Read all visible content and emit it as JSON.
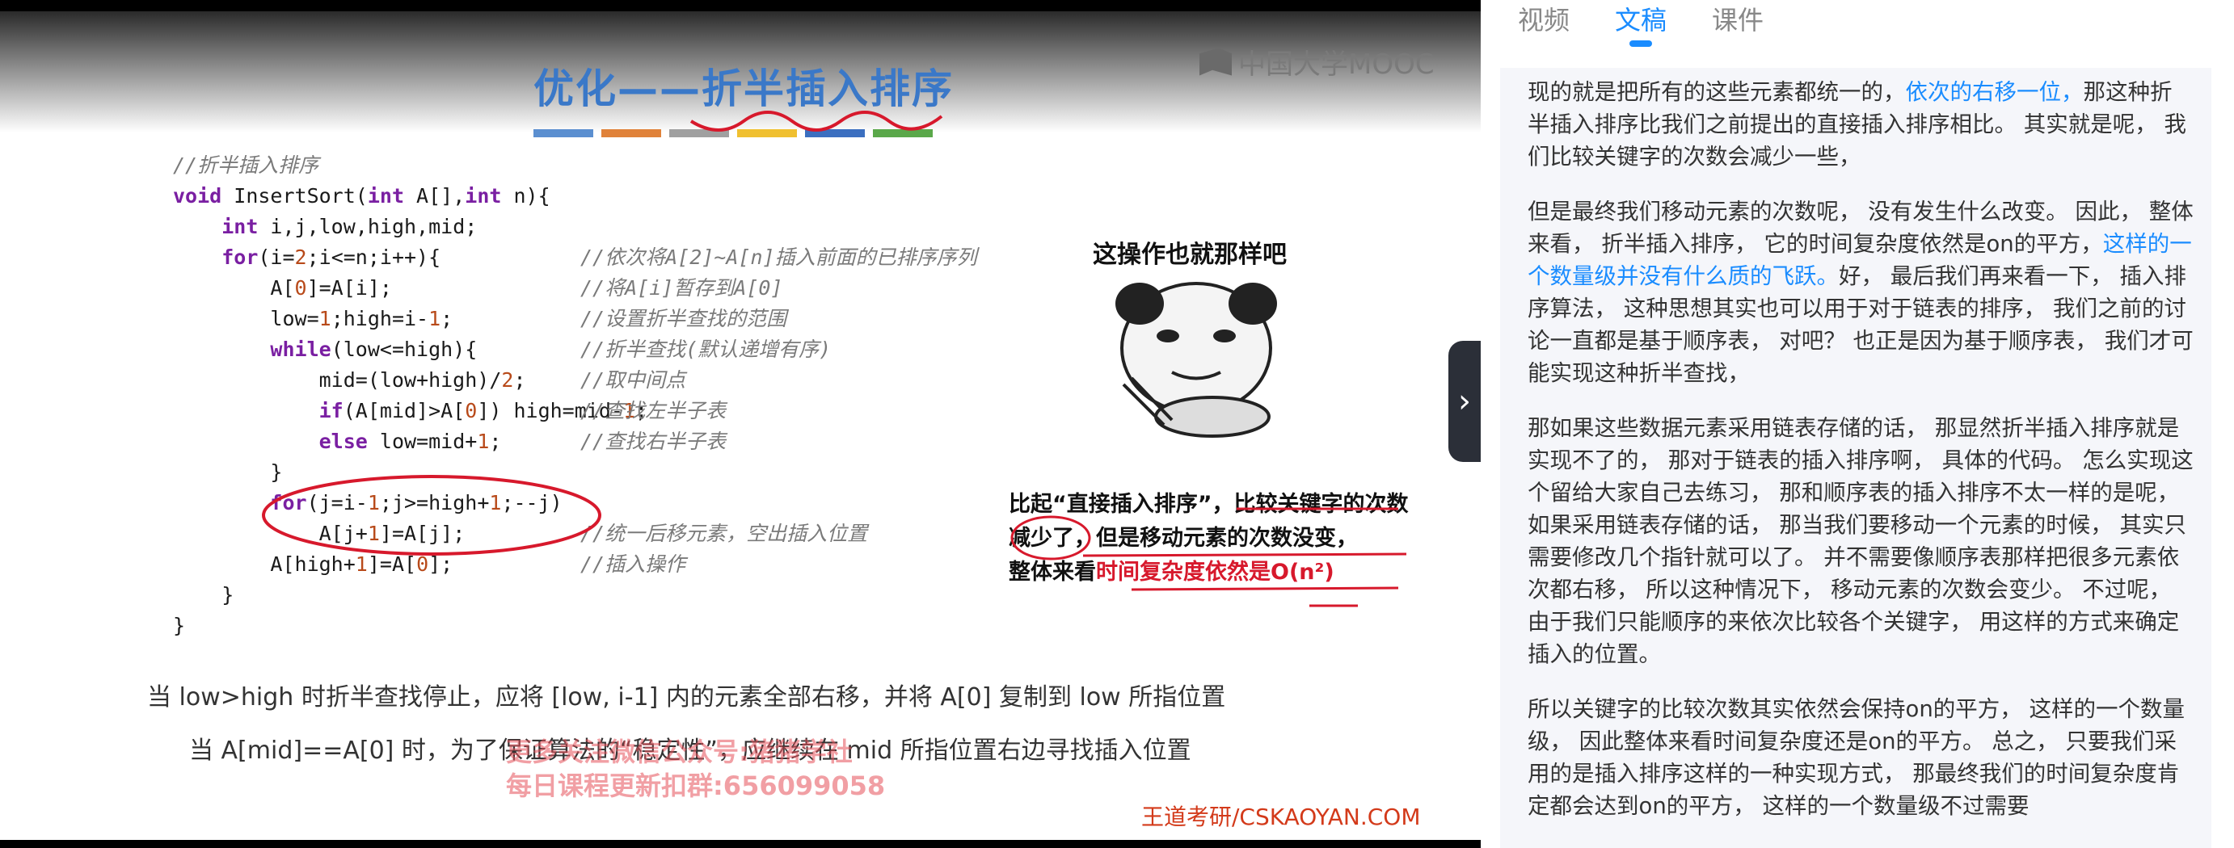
{
  "slide": {
    "title": "优化——折半插入排序",
    "logo": "中国大学MOOC",
    "code_lines": [
      {
        "code": "//折半插入排序",
        "comment": ""
      },
      {
        "code": "void InsertSort(int A[],int n){",
        "comment": ""
      },
      {
        "code": "    int i,j,low,high,mid;",
        "comment": ""
      },
      {
        "code": "    for(i=2;i<=n;i++){",
        "comment": "//依次将A[2]~A[n]插入前面的已排序序列"
      },
      {
        "code": "        A[0]=A[i];",
        "comment": "//将A[i]暂存到A[0]"
      },
      {
        "code": "        low=1;high=i-1;",
        "comment": "//设置折半查找的范围"
      },
      {
        "code": "        while(low<=high){",
        "comment": "//折半查找(默认递增有序)"
      },
      {
        "code": "            mid=(low+high)/2;",
        "comment": "//取中间点"
      },
      {
        "code": "            if(A[mid]>A[0]) high=mid-1;",
        "comment": "//查找左半子表"
      },
      {
        "code": "            else low=mid+1;",
        "comment": "//查找右半子表"
      },
      {
        "code": "        }",
        "comment": ""
      },
      {
        "code": "        for(j=i-1;j>=high+1;--j)",
        "comment": ""
      },
      {
        "code": "            A[j+1]=A[j];",
        "comment": "//统一后移元素，空出插入位置"
      },
      {
        "code": "        A[high+1]=A[0];",
        "comment": "//插入操作"
      },
      {
        "code": "    }",
        "comment": ""
      },
      {
        "code": "}",
        "comment": ""
      }
    ],
    "meme_caption": "这操作也就那样吧",
    "compare_note": {
      "line1": "比起“直接插入排序”，比较关键字的次数减少了，但是移动元素的次数没变，",
      "line2_prefix": "整体来看",
      "line2_red": "时间复杂度依然是O(n²)"
    },
    "footnote1": "当 low>high 时折半查找停止，应将 [low, i-1] 内的元素全部右移，并将 A[0] 复制到 low 所指位置",
    "footnote2": "当 A[mid]==A[0] 时，为了保证算法的“稳定性”，应继续在 mid 所指位置右边寻找插入位置",
    "watermark1": "更多关注微信公众号:猪猪学社",
    "watermark2": "每日课程更新扣群:656099058",
    "site": "王道考研/CSKAOYAN.COM"
  },
  "tabs": [
    "视频",
    "文稿",
    "课件"
  ],
  "active_tab": "文稿",
  "transcript": {
    "p1": {
      "a": "现的就是把所有的这些元素都统一的，",
      "hl": "依次的右移一位，",
      "b": "那这种折半插入排序比我们之前提出的直接插入排序相比。 其实就是呢， 我们比较关键字的次数会减少一些，"
    },
    "p2": {
      "a": "但是最终我们移动元素的次数呢， 没有发生什么改变。 因此， 整体来看， 折半插入排序， 它的时间复杂度依然是on的平方，",
      "hl": "这样的一个数量级并没有什么质的飞跃。",
      "b": "好， 最后我们再来看一下， 插入排序算法， 这种思想其实也可以用于对于链表的排序， 我们之前的讨论一直都是基于顺序表， 对吧？ 也正是因为基于顺序表， 我们才可能实现这种折半查找，"
    },
    "p3": "那如果这些数据元素采用链表存储的话， 那显然折半插入排序就是实现不了的， 那对于链表的插入排序啊， 具体的代码。 怎么实现这个留给大家自己去练习， 那和顺序表的插入排序不太一样的是呢， 如果采用链表存储的话， 那当我们要移动一个元素的时候， 其实只需要修改几个指针就可以了。 并不需要像顺序表那样把很多元素依次都右移， 所以这种情况下， 移动元素的次数会变少。 不过呢， 由于我们只能顺序的来依次比较各个关键字， 用这样的方式来确定插入的位置。",
    "p4": "所以关键字的比较次数其实依然会保持on的平方， 这样的一个数量级， 因此整体来看时间复杂度还是on的平方。 总之， 只要我们采用的是插入排序这样的一种实现方式， 那最终我们的时间复杂度肯定都会达到on的平方， 这样的一个数量级不过需要"
  },
  "colors": {
    "title_blue": "#3a78c8",
    "accent_blue": "#1a8cff",
    "annotation_red": "#d7192c",
    "title_bar": [
      "#5b8fd0",
      "#e0823a",
      "#a0a0a0",
      "#f0c030",
      "#3b6fc0",
      "#5aa84a"
    ]
  }
}
